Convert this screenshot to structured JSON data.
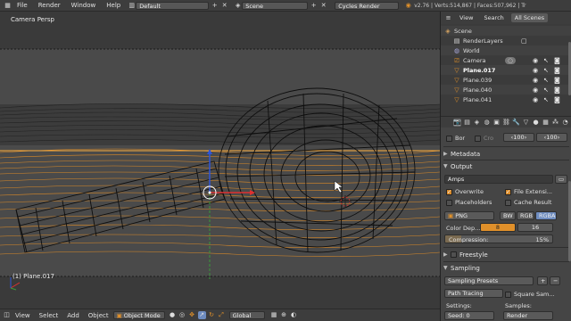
{
  "topbar": {
    "menus": [
      "File",
      "Render",
      "Window",
      "Help"
    ],
    "screen_layout": "Default",
    "scene": "Scene",
    "engine": "Cycles Render",
    "stats": "v2.76 | Verts:514,867 | Faces:507,962 | Tr"
  },
  "viewport": {
    "view_label": "Camera Persp",
    "object_label": "(1) Plane.017"
  },
  "bottombar": {
    "menus": [
      "View",
      "Select",
      "Add",
      "Object"
    ],
    "mode": "Object Mode",
    "orientation": "Global"
  },
  "outliner": {
    "tabs": [
      "View",
      "Search",
      "All Scenes"
    ],
    "rows": [
      {
        "label": "Scene",
        "icon": "scene-icon"
      },
      {
        "label": "RenderLayers",
        "icon": "renderlayers-icon"
      },
      {
        "label": "World",
        "icon": "world-icon"
      },
      {
        "label": "Camera",
        "icon": "camera-icon"
      },
      {
        "label": "Plane.017",
        "icon": "mesh-icon"
      },
      {
        "label": "Plane.039",
        "icon": "mesh-icon"
      },
      {
        "label": "Plane.040",
        "icon": "mesh-icon"
      },
      {
        "label": "Plane.041",
        "icon": "mesh-icon"
      }
    ]
  },
  "properties": {
    "border_label": "Bor",
    "crop_label": "Cro",
    "res_x": "100",
    "res_y": "100",
    "metadata_label": "Metadata",
    "output_label": "Output",
    "output_path": "Amps",
    "overwrite_label": "Overwrite",
    "file_ext_label": "File Extensi...",
    "placeholders_label": "Placeholders",
    "cache_result_label": "Cache Result",
    "format": "PNG",
    "color_modes": [
      "BW",
      "RGB",
      "RGBA"
    ],
    "active_color_mode": "RGBA",
    "color_depth_label": "Color Dep...",
    "color_depths": [
      "8",
      "16"
    ],
    "active_depth": "8",
    "compression_label": "Compression:",
    "compression_value": "15%",
    "compression_fraction": 0.15,
    "freestyle_label": "Freestyle",
    "sampling_label": "Sampling",
    "sampling_presets": "Sampling Presets",
    "path_tracing": "Path Tracing",
    "square_samples": "Square Sam...",
    "settings_label": "Settings:",
    "samples_label": "Samples:",
    "seed_label": "Seed: 0",
    "render_label": "Render"
  },
  "colors": {
    "accent_orange": "#e0902a",
    "selection_blue": "#5680c2",
    "wire_orange": "#ff9a1f"
  }
}
